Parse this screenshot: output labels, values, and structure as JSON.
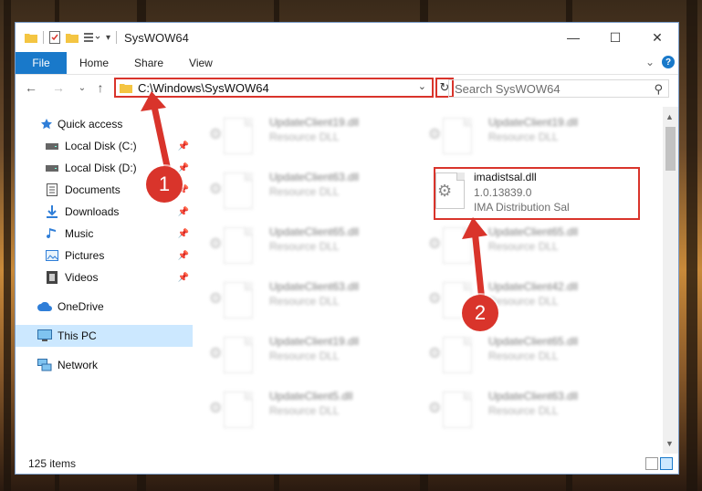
{
  "window": {
    "title": "SysWOW64",
    "controls": {
      "minimize": "—",
      "maximize": "☐",
      "close": "✕"
    }
  },
  "ribbon": {
    "tabs": [
      "File",
      "Home",
      "Share",
      "View"
    ],
    "expand_glyph": "⌄",
    "help_glyph": "?"
  },
  "navbar": {
    "back": "←",
    "forward": "→",
    "recent": "⌄",
    "up": "↑",
    "address": "C:\\Windows\\SysWOW64",
    "refresh": "↻",
    "search_placeholder": "Search SysWOW64"
  },
  "sidebar": {
    "items": [
      {
        "label": "Quick access",
        "icon": "star-icon",
        "pinned": false
      },
      {
        "label": "Local Disk (C:)",
        "icon": "drive-icon",
        "pinned": true
      },
      {
        "label": "Local Disk (D:)",
        "icon": "drive-icon",
        "pinned": true
      },
      {
        "label": "Documents",
        "icon": "document-icon",
        "pinned": true
      },
      {
        "label": "Downloads",
        "icon": "download-icon",
        "pinned": true
      },
      {
        "label": "Music",
        "icon": "music-icon",
        "pinned": true
      },
      {
        "label": "Pictures",
        "icon": "pictures-icon",
        "pinned": true
      },
      {
        "label": "Videos",
        "icon": "videos-icon",
        "pinned": true
      },
      {
        "label": "OneDrive",
        "icon": "cloud-icon",
        "pinned": false
      },
      {
        "label": "This PC",
        "icon": "computer-icon",
        "pinned": false,
        "selected": true
      },
      {
        "label": "Network",
        "icon": "network-icon",
        "pinned": false
      }
    ]
  },
  "files": {
    "left_column": [
      {
        "name": "UpdateClient19.dll",
        "type": "Resource DLL"
      },
      {
        "name": "UpdateClient63.dll",
        "type": "Resource DLL"
      },
      {
        "name": "UpdateClient65.dll",
        "type": "Resource DLL"
      },
      {
        "name": "UpdateClient63.dll",
        "type": "Resource DLL"
      },
      {
        "name": "UpdateClient19.dll",
        "type": "Resource DLL"
      },
      {
        "name": "UpdateClient5.dll",
        "type": "Resource DLL"
      }
    ],
    "right_column": [
      {
        "name": "UpdateClient19.dll",
        "type": "Resource DLL"
      },
      {
        "name": "UpdateClient65.dll",
        "type": "Resource DLL"
      },
      {
        "name": "UpdateClient42.dll",
        "type": "Resource DLL"
      },
      {
        "name": "UpdateClient65.dll",
        "type": "Resource DLL"
      },
      {
        "name": "UpdateClient63.dll",
        "type": "Resource DLL"
      }
    ],
    "target": {
      "name": "imadistsal.dll",
      "version": "1.0.13839.0",
      "description": "IMA Distribution Sal"
    }
  },
  "status": {
    "item_count": "125 items"
  },
  "callouts": {
    "first": "1",
    "second": "2"
  },
  "colors": {
    "accent": "#1979ca",
    "annotation": "#d9342b",
    "selected": "#cce8ff"
  }
}
